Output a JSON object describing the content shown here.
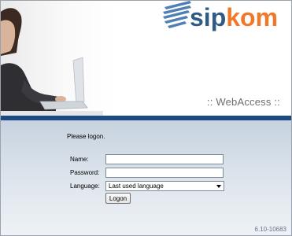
{
  "header": {
    "logo_part1": "sip",
    "logo_part2": "kom",
    "subtitle": ":: WebAccess ::"
  },
  "login": {
    "prompt": "Please logon.",
    "name_label": "Name:",
    "name_value": "",
    "password_label": "Password:",
    "password_value": "",
    "language_label": "Language:",
    "language_selected": "Last used language",
    "logon_button": "Logon"
  },
  "footer": {
    "version": "6.10-10683"
  },
  "colors": {
    "brand_blue": "#2f5b86",
    "brand_orange": "#f07828",
    "bar_blue": "#1d4a82"
  }
}
